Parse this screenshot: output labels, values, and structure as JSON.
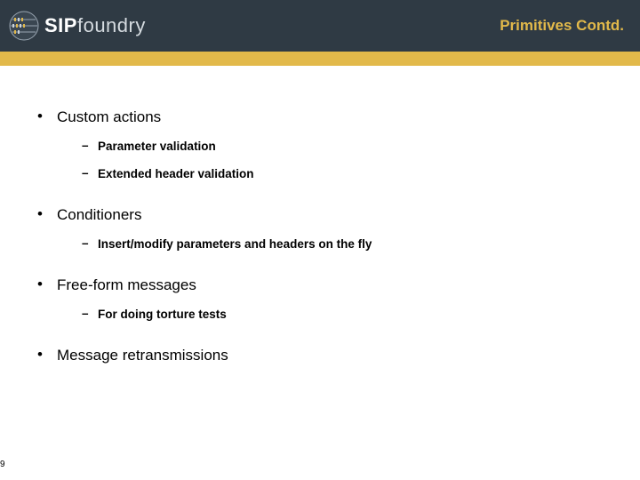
{
  "header": {
    "logo_sip": "SIP",
    "logo_foundry": "foundry",
    "title": "Primitives Contd."
  },
  "bullets": [
    {
      "text": "Custom actions",
      "children": [
        {
          "text": "Parameter validation"
        },
        {
          "text": "Extended header validation"
        }
      ]
    },
    {
      "text": "Conditioners",
      "children": [
        {
          "text": "Insert/modify parameters and headers on the fly"
        }
      ]
    },
    {
      "text": "Free-form messages",
      "children": [
        {
          "text": "For doing torture tests"
        }
      ]
    },
    {
      "text": "Message retransmissions",
      "children": []
    }
  ],
  "page_number": "9"
}
